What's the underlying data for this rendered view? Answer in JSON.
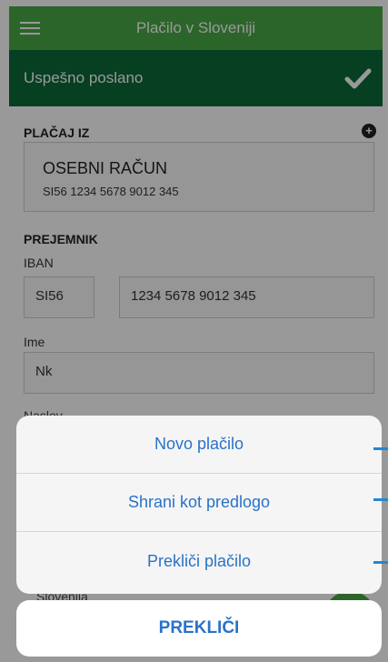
{
  "header": {
    "title": "Plačilo v Sloveniji"
  },
  "status": {
    "message": "Uspešno poslano"
  },
  "pay_from": {
    "label": "PLAČAJ IZ",
    "account_name": "OSEBNI RAČUN",
    "account_iban": "SI56 1234 5678 9012 345"
  },
  "recipient": {
    "label": "PREJEMNIK",
    "iban_label": "IBAN",
    "iban_prefix": "SI56",
    "iban_number": "1234 5678 9012 345",
    "name_label": "Ime",
    "name_value": "Nk",
    "address_label_partial": "Naslov",
    "country_partial": "Slovenija"
  },
  "action_sheet": {
    "items": [
      "Novo plačilo",
      "Shrani kot predlogo",
      "Prekliči plačilo"
    ],
    "cancel": "PREKLIČI"
  },
  "colors": {
    "nav_green": "#4aa846",
    "success_green": "#0b6a3a",
    "action_blue": "#2a72c8"
  }
}
